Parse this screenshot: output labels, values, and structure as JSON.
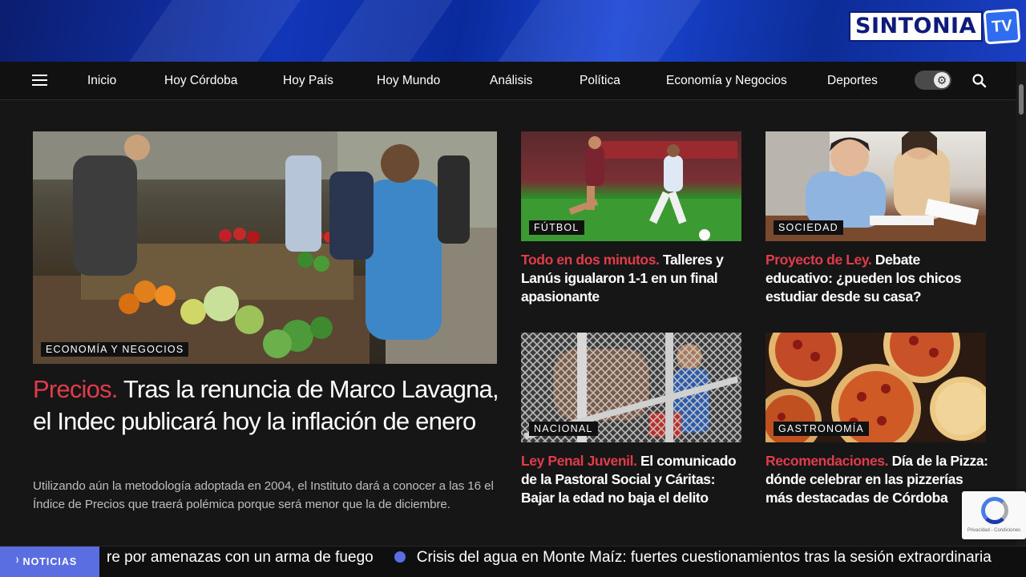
{
  "brand": {
    "name": "SINTONIA",
    "suffix": "TV"
  },
  "nav": {
    "items": [
      "Inicio",
      "Hoy Córdoba",
      "Hoy País",
      "Hoy Mundo",
      "Análisis",
      "Política",
      "Economía y Negocios",
      "Deportes"
    ]
  },
  "main": {
    "tag": "ECONOMÍA Y NEGOCIOS",
    "kicker": "Precios.",
    "title": "Tras la renuncia de Marco Lavagna, el Indec publicará hoy la inflación de enero",
    "summary": "Utilizando aún la metodología adoptada en 2004, el Instituto dará a conocer a las 16 el Índice de Precios que traerá polémica porque será menor que la de diciembre."
  },
  "cards": [
    {
      "tag": "FÚTBOL",
      "kicker": "Todo en dos minutos.",
      "title": "Talleres y Lanús igualaron 1-1 en un final apasionante"
    },
    {
      "tag": "SOCIEDAD",
      "kicker": "Proyecto de Ley.",
      "title": "Debate educativo: ¿pueden los chicos estudiar desde su casa?"
    },
    {
      "tag": "NACIONAL",
      "kicker": "Ley Penal Juvenil.",
      "title": "El comunicado de la Pastoral Social y Cáritas: Bajar la edad no baja el delito"
    },
    {
      "tag": "GASTRONOMÍA",
      "kicker": "Recomendaciones.",
      "title": "Día de la Pizza: dónde celebrar en las pizzerías más destacadas de Córdoba"
    }
  ],
  "recaptcha": {
    "text": "Privacidad - Condiciones"
  },
  "ticker": {
    "label": "NOTICIAS",
    "items": [
      "re por amenazas con un arma de fuego",
      "Crisis del agua en Monte Maíz: fuertes cuestionamientos tras la sesión extraordinaria"
    ]
  },
  "colors": {
    "accent": "#e03c4b",
    "ticker": "#5b6ee1",
    "background": "#161616"
  },
  "icons": [
    "menu-icon",
    "settings-icon",
    "search-icon",
    "rss-icon"
  ]
}
